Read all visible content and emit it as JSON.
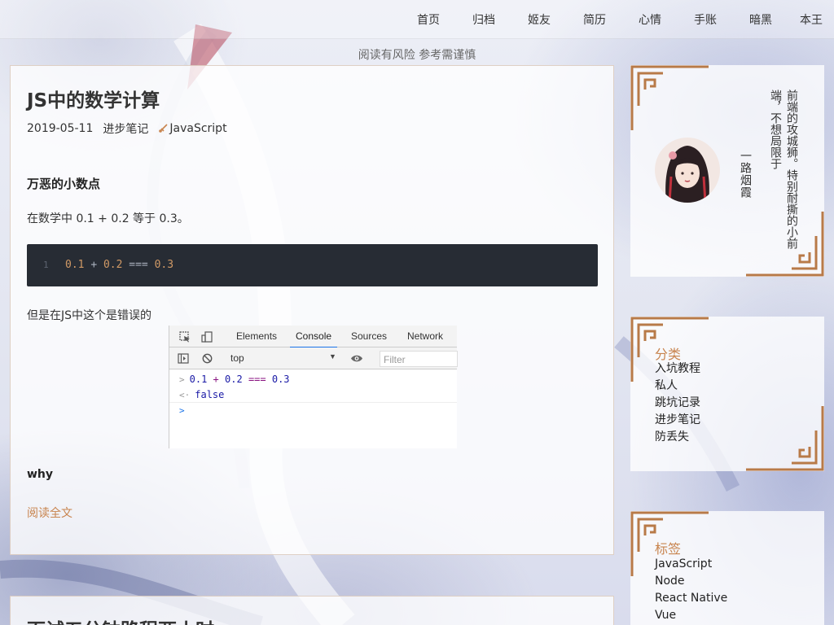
{
  "nav": {
    "items": [
      "首页",
      "归档",
      "姬友",
      "简历",
      "心情",
      "手账",
      "暗黑",
      "本王"
    ]
  },
  "tagline": "阅读有风险 参考需谨慎",
  "article": {
    "title": "JS中的数学计算",
    "date": "2019-05-11",
    "category": "进步笔记",
    "tag": "JavaScript",
    "heading": "万恶的小数点",
    "paragraph1": "在数学中 0.1 + 0.2 等于 0.3。",
    "code": {
      "line_number": "1",
      "a": "0.1",
      "plus": "+",
      "b": "0.2",
      "eq": "===",
      "c": "0.3"
    },
    "paragraph2": "但是在JS中这个是错误的",
    "devtools": {
      "tabs": [
        "Elements",
        "Console",
        "Sources",
        "Network"
      ],
      "active_tab": "Console",
      "context": "top",
      "filter_placeholder": "Filter",
      "input_prompt": ">",
      "result_prompt": "<·",
      "cmd_a": "0.1",
      "cmd_plus": "+",
      "cmd_b": "0.2",
      "cmd_eq": "===",
      "cmd_c": "0.3",
      "result": "false",
      "empty_prompt": ">"
    },
    "why": "why",
    "read_more": "阅读全文"
  },
  "article2": {
    "title": "面试五分钟路程两小时"
  },
  "profile": {
    "name": "一路烟霞",
    "motto": "前端的攻城狮。特别耐撕的小前端，不想局限于"
  },
  "categories": {
    "title": "分类",
    "items": [
      "入坑教程",
      "私人",
      "跳坑记录",
      "进步笔记",
      "防丢失"
    ]
  },
  "tags": {
    "title": "标签",
    "items": [
      "JavaScript",
      "Node",
      "React Native",
      "Vue"
    ]
  },
  "colors": {
    "accent": "#c8844e",
    "code_bg": "#272c34",
    "code_number": "#d19a66"
  }
}
